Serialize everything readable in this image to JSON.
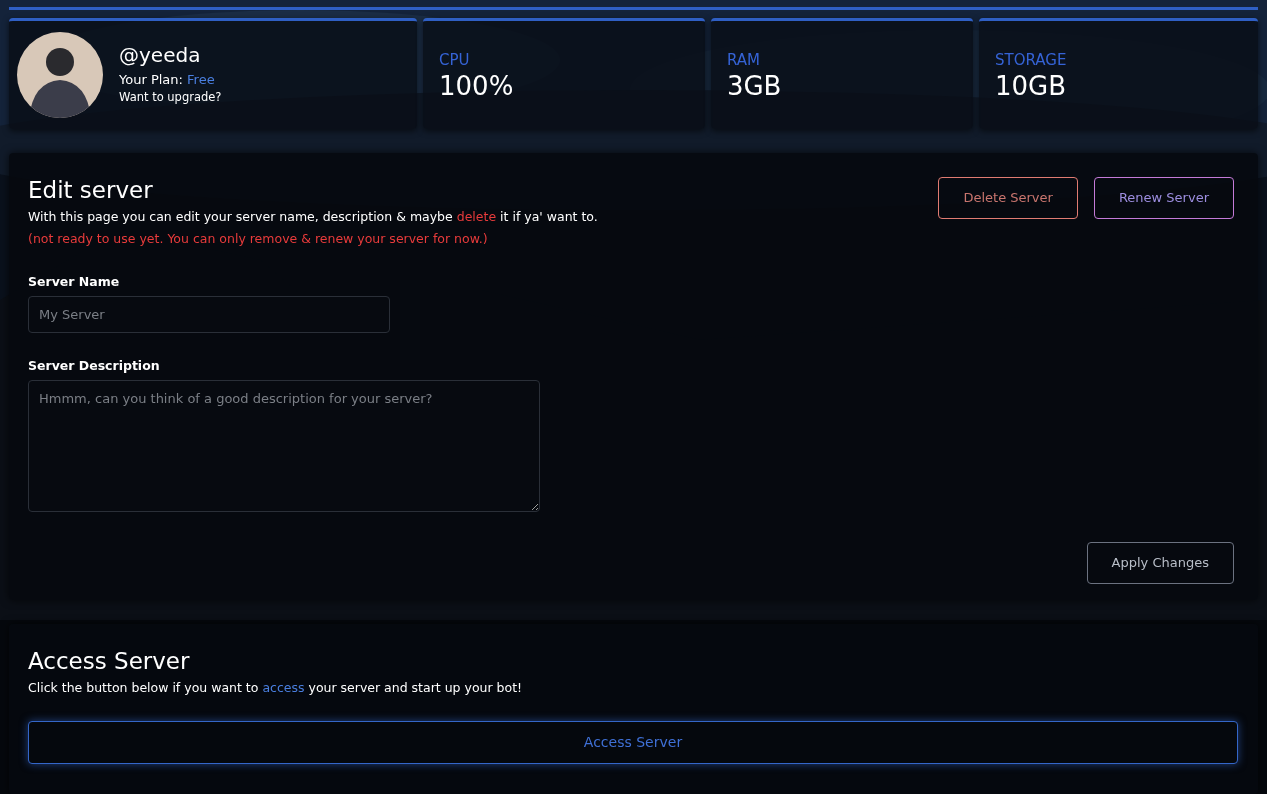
{
  "profile": {
    "username": "@yeeda",
    "plan": [
      {
        "kind": "plain",
        "text": "Your Plan: "
      },
      {
        "kind": "accent",
        "text": "Free"
      }
    ],
    "upgrade": "Want to upgrade?"
  },
  "stats": [
    {
      "label": "CPU",
      "value": "100%"
    },
    {
      "label": "RAM",
      "value": "3GB"
    },
    {
      "label": "STORAGE",
      "value": "10GB"
    }
  ],
  "edit_server": {
    "title": "Edit server",
    "description": [
      {
        "kind": "plain",
        "text": "With this page you can edit your server name, description & maybe "
      },
      {
        "kind": "danger",
        "text": "delete"
      },
      {
        "kind": "plain",
        "text": " it if ya' want to."
      }
    ],
    "notice": "(not ready to use yet. You can only remove & renew your server for now.)",
    "buttons": [
      {
        "label": "Delete Server",
        "kind": "danger"
      },
      {
        "label": "Renew Server",
        "kind": "violet"
      }
    ],
    "fields": [
      {
        "label": "Server Name",
        "kind": "input",
        "placeholder": "My Server"
      },
      {
        "label": "Server Description",
        "kind": "textarea",
        "placeholder": "Hmmm, can you think of a good description for your server?"
      }
    ],
    "apply_button": "Apply Changes"
  },
  "access_server": {
    "title": "Access Server",
    "description": [
      {
        "kind": "plain",
        "text": "Click the button below if you want to "
      },
      {
        "kind": "accent",
        "text": "access"
      },
      {
        "kind": "plain",
        "text": " your server and start up your bot!"
      }
    ],
    "button": "Access Server"
  }
}
